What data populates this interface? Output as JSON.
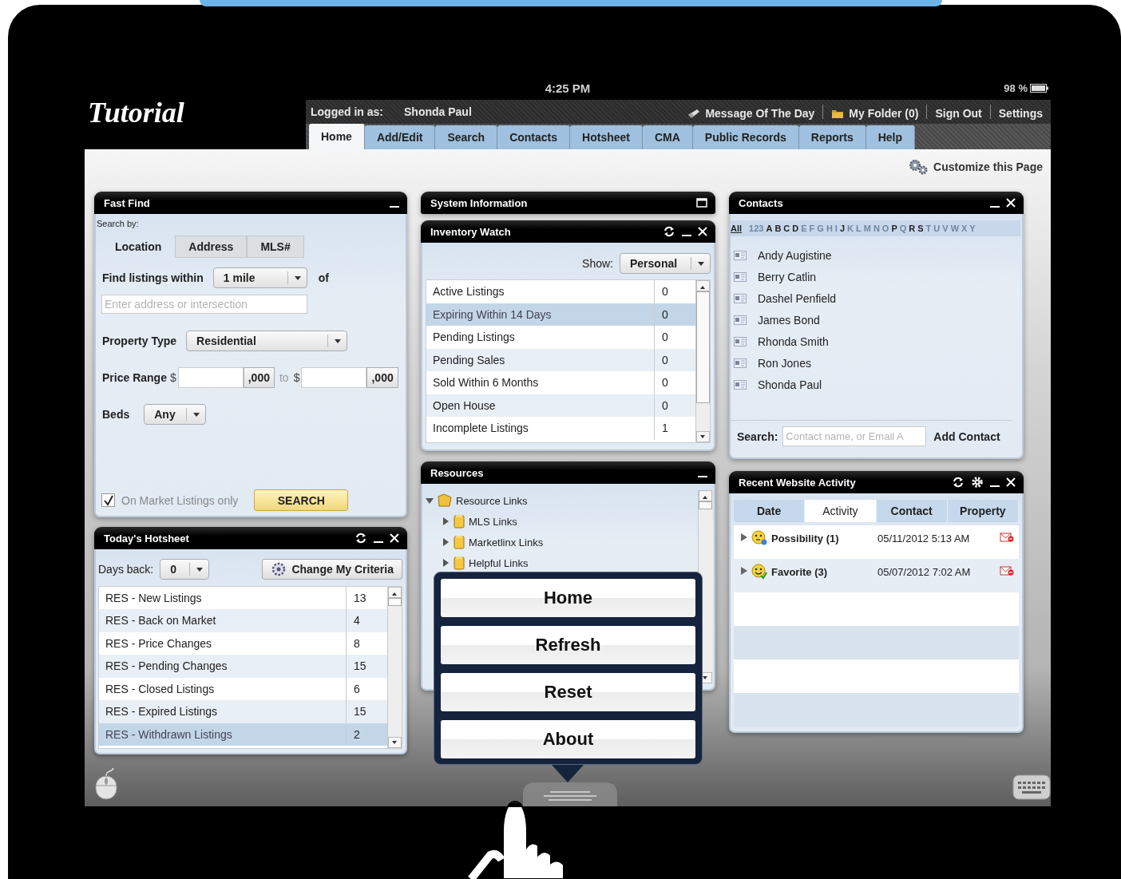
{
  "status_bar": {
    "time": "4:25 PM",
    "battery": "98 %"
  },
  "overlay_title": "Tutorial",
  "header": {
    "logged_in_label": "Logged in as:",
    "user": "Shonda Paul",
    "links": [
      {
        "label": "Message Of The Day",
        "kind": "message"
      },
      {
        "label": "My Folder (0)",
        "kind": "folder"
      },
      {
        "label": "Sign Out",
        "kind": "plain"
      },
      {
        "label": "Settings",
        "kind": "plain"
      }
    ]
  },
  "tabs": [
    {
      "label": "Home",
      "selected": true
    },
    {
      "label": "Add/Edit",
      "selected": false
    },
    {
      "label": "Search",
      "selected": false
    },
    {
      "label": "Contacts",
      "selected": false
    },
    {
      "label": "Hotsheet",
      "selected": false
    },
    {
      "label": "CMA",
      "selected": false
    },
    {
      "label": "Public Records",
      "selected": false
    },
    {
      "label": "Reports",
      "selected": false
    },
    {
      "label": "Help",
      "selected": false
    }
  ],
  "customize": "Customize this Page",
  "fast_find": {
    "title": "Fast Find",
    "search_by": "Search by:",
    "tabs": [
      {
        "label": "Location",
        "selected": true
      },
      {
        "label": "Address",
        "selected": false
      },
      {
        "label": "MLS#",
        "selected": false
      }
    ],
    "within_label": "Find listings within",
    "within_value": "1 mile",
    "of_label": "of",
    "address_placeholder": "Enter address or intersection",
    "property_type_label": "Property Type",
    "property_type_value": "Residential",
    "price_label": "Price Range",
    "currency": "$",
    "thousands": ",000",
    "to_label": "to",
    "currency_2": "$",
    "thousands_2": ",000",
    "beds_label": "Beds",
    "beds_value": "Any",
    "on_market": {
      "label": "On Market Listings only",
      "checked": true
    },
    "search_button": "SEARCH"
  },
  "hotsheet": {
    "title": "Today's Hotsheet",
    "days_back_label": "Days back:",
    "days_back_value": "0",
    "criteria_button": "Change My Criteria",
    "rows": [
      {
        "name": "RES - New Listings",
        "count": "13",
        "selected": false
      },
      {
        "name": "RES - Back on Market",
        "count": "4",
        "selected": false
      },
      {
        "name": "RES - Price Changes",
        "count": "8",
        "selected": false
      },
      {
        "name": "RES - Pending Changes",
        "count": "15",
        "selected": false
      },
      {
        "name": "RES - Closed Listings",
        "count": "6",
        "selected": false
      },
      {
        "name": "RES - Expired Listings",
        "count": "15",
        "selected": false
      },
      {
        "name": "RES - Withdrawn Listings",
        "count": "2",
        "selected": true
      }
    ]
  },
  "system_info": {
    "title": "System Information"
  },
  "inventory": {
    "title": "Inventory Watch",
    "show_label": "Show:",
    "show_value": "Personal",
    "rows": [
      {
        "name": "Active Listings",
        "count": "0",
        "selected": false
      },
      {
        "name": "Expiring Within 14 Days",
        "count": "0",
        "selected": true
      },
      {
        "name": "Pending Listings",
        "count": "0",
        "selected": false
      },
      {
        "name": "Pending Sales",
        "count": "0",
        "selected": false
      },
      {
        "name": "Sold Within 6 Months",
        "count": "0",
        "selected": false
      },
      {
        "name": "Open House",
        "count": "0",
        "selected": false
      },
      {
        "name": "Incomplete Listings",
        "count": "1",
        "selected": false
      }
    ]
  },
  "resources": {
    "title": "Resources",
    "tree": [
      {
        "label": "Resource Links",
        "expanded": true,
        "children": [
          {
            "label": "MLS Links",
            "expanded": false
          },
          {
            "label": "Marketlinx Links",
            "expanded": false
          },
          {
            "label": "Helpful Links",
            "expanded": false
          }
        ]
      }
    ]
  },
  "contacts": {
    "title": "Contacts",
    "alphabet": [
      {
        "label": "All",
        "selected": true,
        "enabled": true
      },
      {
        "label": "123",
        "selected": false,
        "enabled": false
      },
      {
        "label": "A",
        "selected": false,
        "enabled": true
      },
      {
        "label": "B",
        "selected": false,
        "enabled": true
      },
      {
        "label": "C",
        "selected": false,
        "enabled": true
      },
      {
        "label": "D",
        "selected": false,
        "enabled": true
      },
      {
        "label": "E",
        "selected": false,
        "enabled": false
      },
      {
        "label": "F",
        "selected": false,
        "enabled": false
      },
      {
        "label": "G",
        "selected": false,
        "enabled": false
      },
      {
        "label": "H",
        "selected": false,
        "enabled": false
      },
      {
        "label": "I",
        "selected": false,
        "enabled": false
      },
      {
        "label": "J",
        "selected": false,
        "enabled": true
      },
      {
        "label": "K",
        "selected": false,
        "enabled": false
      },
      {
        "label": "L",
        "selected": false,
        "enabled": false
      },
      {
        "label": "M",
        "selected": false,
        "enabled": false
      },
      {
        "label": "N",
        "selected": false,
        "enabled": false
      },
      {
        "label": "O",
        "selected": false,
        "enabled": false
      },
      {
        "label": "P",
        "selected": false,
        "enabled": true
      },
      {
        "label": "Q",
        "selected": false,
        "enabled": false
      },
      {
        "label": "R",
        "selected": false,
        "enabled": true
      },
      {
        "label": "S",
        "selected": false,
        "enabled": true
      },
      {
        "label": "T",
        "selected": false,
        "enabled": false
      },
      {
        "label": "U",
        "selected": false,
        "enabled": false
      },
      {
        "label": "V",
        "selected": false,
        "enabled": false
      },
      {
        "label": "W",
        "selected": false,
        "enabled": false
      },
      {
        "label": "X",
        "selected": false,
        "enabled": false
      },
      {
        "label": "Y",
        "selected": false,
        "enabled": false
      }
    ],
    "items": [
      "Andy Augistine",
      "Berry Catlin",
      "Dashel Penfield",
      "James Bond",
      "Rhonda Smith",
      "Ron Jones",
      "Shonda Paul"
    ],
    "search_label": "Search:",
    "search_placeholder": "Contact name, or Email A",
    "add_button": "Add Contact"
  },
  "activity": {
    "title": "Recent Website Activity",
    "tabs": [
      {
        "label": "Date",
        "selected": false
      },
      {
        "label": "Activity",
        "selected": true
      },
      {
        "label": "Contact",
        "selected": false
      },
      {
        "label": "Property",
        "selected": false
      }
    ],
    "rows": [
      {
        "label": "Possibility (1)",
        "date": "05/11/2012 5:13 AM",
        "kind": "possibility"
      },
      {
        "label": "Favorite (3)",
        "date": "05/07/2012 7:02 AM",
        "kind": "favorite"
      }
    ]
  },
  "menu": {
    "items": [
      "Home",
      "Refresh",
      "Reset",
      "About"
    ]
  }
}
